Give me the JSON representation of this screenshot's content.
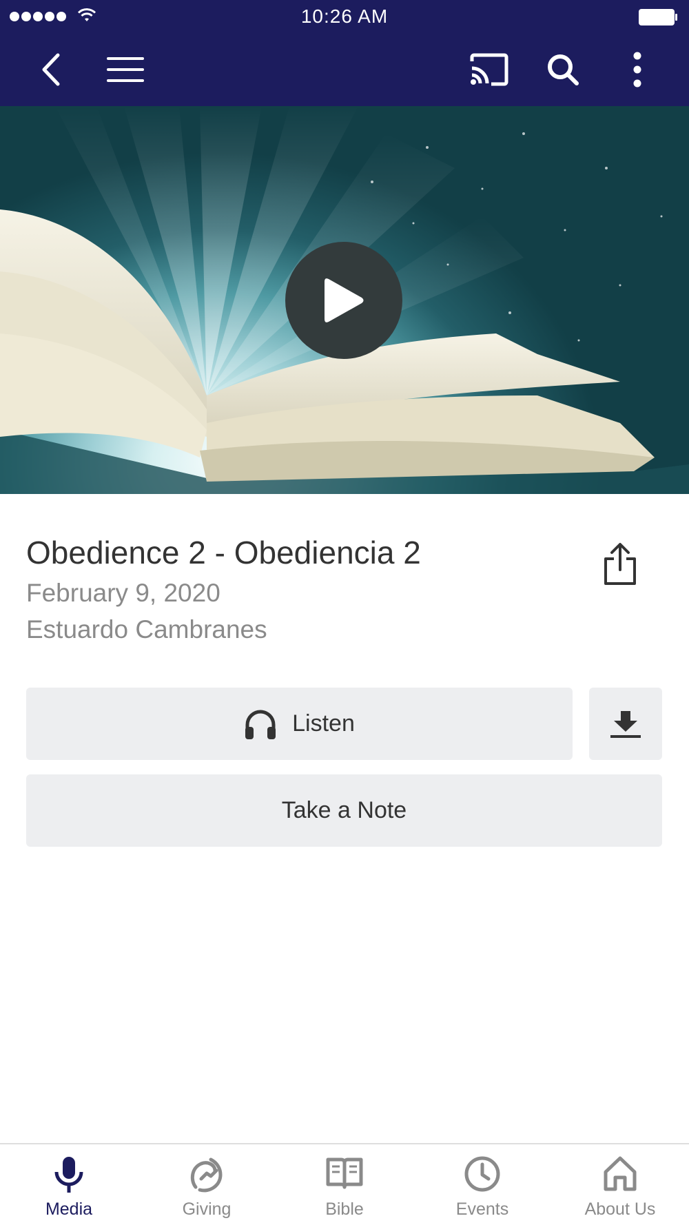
{
  "status_bar": {
    "time": "10:26 AM"
  },
  "app_bar": {
    "icons": [
      "back-icon",
      "hamburger-menu-icon",
      "cast-icon",
      "search-icon",
      "more-vertical-icon"
    ],
    "background_color": "#1c1c5e"
  },
  "media": {
    "title": "Obedience 2 - Obediencia 2",
    "date": "February 9, 2020",
    "speaker": "Estuardo Cambranes"
  },
  "actions": {
    "listen_label": "Listen",
    "note_label": "Take a Note"
  },
  "tabs": [
    {
      "label": "Media",
      "icon": "microphone-icon",
      "active": true
    },
    {
      "label": "Giving",
      "icon": "giving-icon",
      "active": false
    },
    {
      "label": "Bible",
      "icon": "bible-icon",
      "active": false
    },
    {
      "label": "Events",
      "icon": "clock-icon",
      "active": false
    },
    {
      "label": "About Us",
      "icon": "home-icon",
      "active": false
    }
  ],
  "colors": {
    "accent": "#1c1c5e",
    "inactive_tab": "#8a8a8a",
    "button_bg": "#edeef0"
  }
}
